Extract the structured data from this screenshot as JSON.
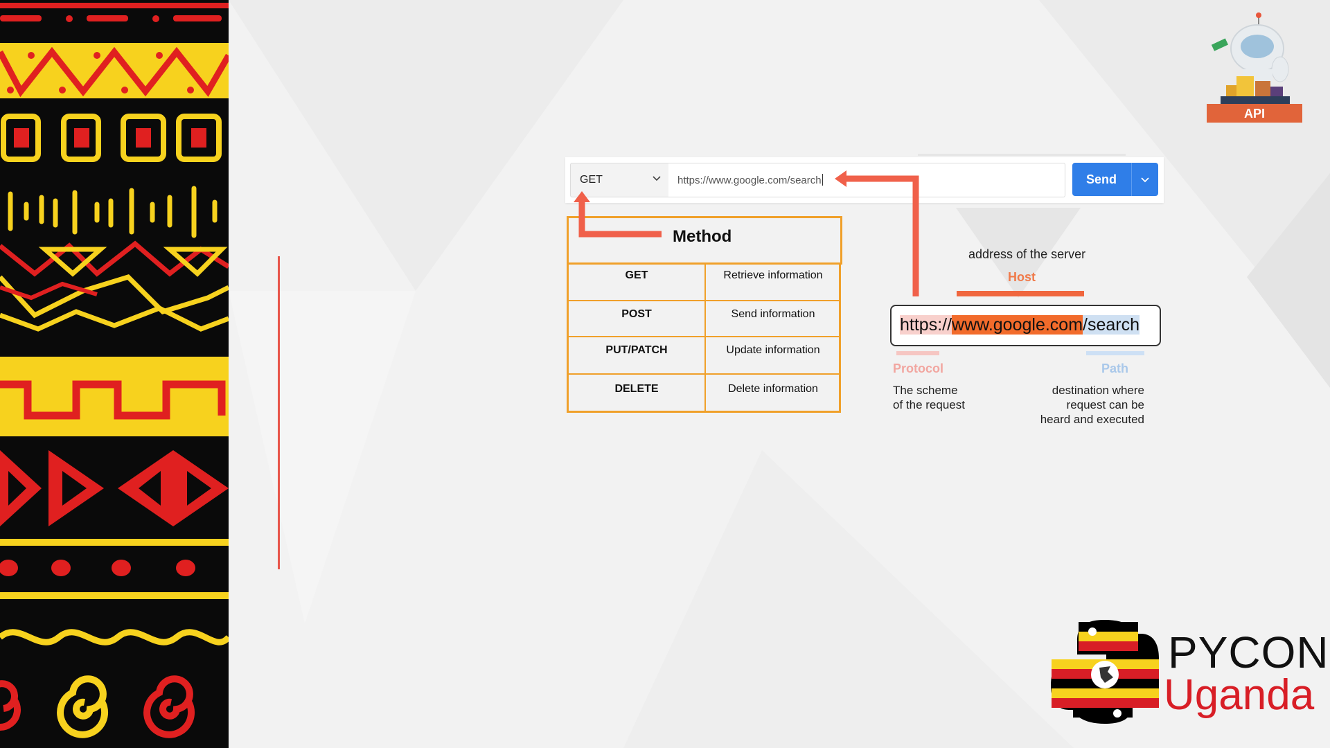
{
  "request_bar": {
    "method_value": "GET",
    "url_value": "https://www.google.com/search",
    "send_label": "Send"
  },
  "method_table": {
    "title": "Method",
    "rows": [
      {
        "method": "GET",
        "description": "Retrieve information"
      },
      {
        "method": "POST",
        "description": "Send information"
      },
      {
        "method": "PUT/PATCH",
        "description": "Update information"
      },
      {
        "method": "DELETE",
        "description": "Delete information"
      }
    ]
  },
  "url_anatomy": {
    "server_caption": "address of the server",
    "host_label": "Host",
    "url_parts": {
      "protocol": "https://",
      "host": "www.google.com",
      "path": "/search"
    },
    "protocol_label": "Protocol",
    "protocol_description_line1": "The scheme",
    "protocol_description_line2": "of the request",
    "path_label": "Path",
    "path_description_line1": "destination where",
    "path_description_line2": "request can be",
    "path_description_line3": "heard and executed"
  },
  "logos": {
    "api_text": "API",
    "pycon_line1": "PYCON",
    "pycon_line2": "Uganda"
  },
  "colors": {
    "accent_orange": "#f26b2b",
    "table_border": "#f0a02a",
    "send_blue": "#2f7ee8",
    "arrow_red": "#f0604a",
    "uganda_red": "#d81e26",
    "uganda_yellow": "#f7d21e"
  }
}
